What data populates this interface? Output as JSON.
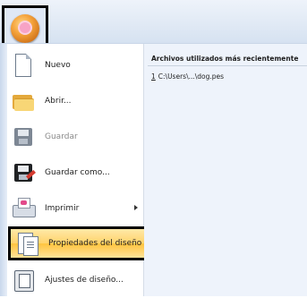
{
  "menu": {
    "items": [
      {
        "label": "Nuevo",
        "icon": "new-document-icon"
      },
      {
        "label": "Abrir...",
        "icon": "open-folder-icon"
      },
      {
        "label": "Guardar",
        "icon": "save-icon",
        "state": "disabled"
      },
      {
        "label": "Guardar como...",
        "icon": "save-as-icon"
      },
      {
        "label": "Imprimir",
        "icon": "printer-icon",
        "submenu": true
      },
      {
        "label": "Propiedades del diseño",
        "icon": "design-properties-icon",
        "state": "highlighted"
      },
      {
        "label": "Ajustes de diseño...",
        "icon": "design-settings-icon"
      }
    ]
  },
  "recent": {
    "header": "Archivos utilizados más recientemente",
    "files": [
      {
        "number": "1",
        "path": "C:\\Users\\...\\dog.pes"
      }
    ]
  },
  "colors": {
    "highlight": "#ffc43e",
    "callout_border": "#000000",
    "panel_bg": "#eef3fb"
  }
}
